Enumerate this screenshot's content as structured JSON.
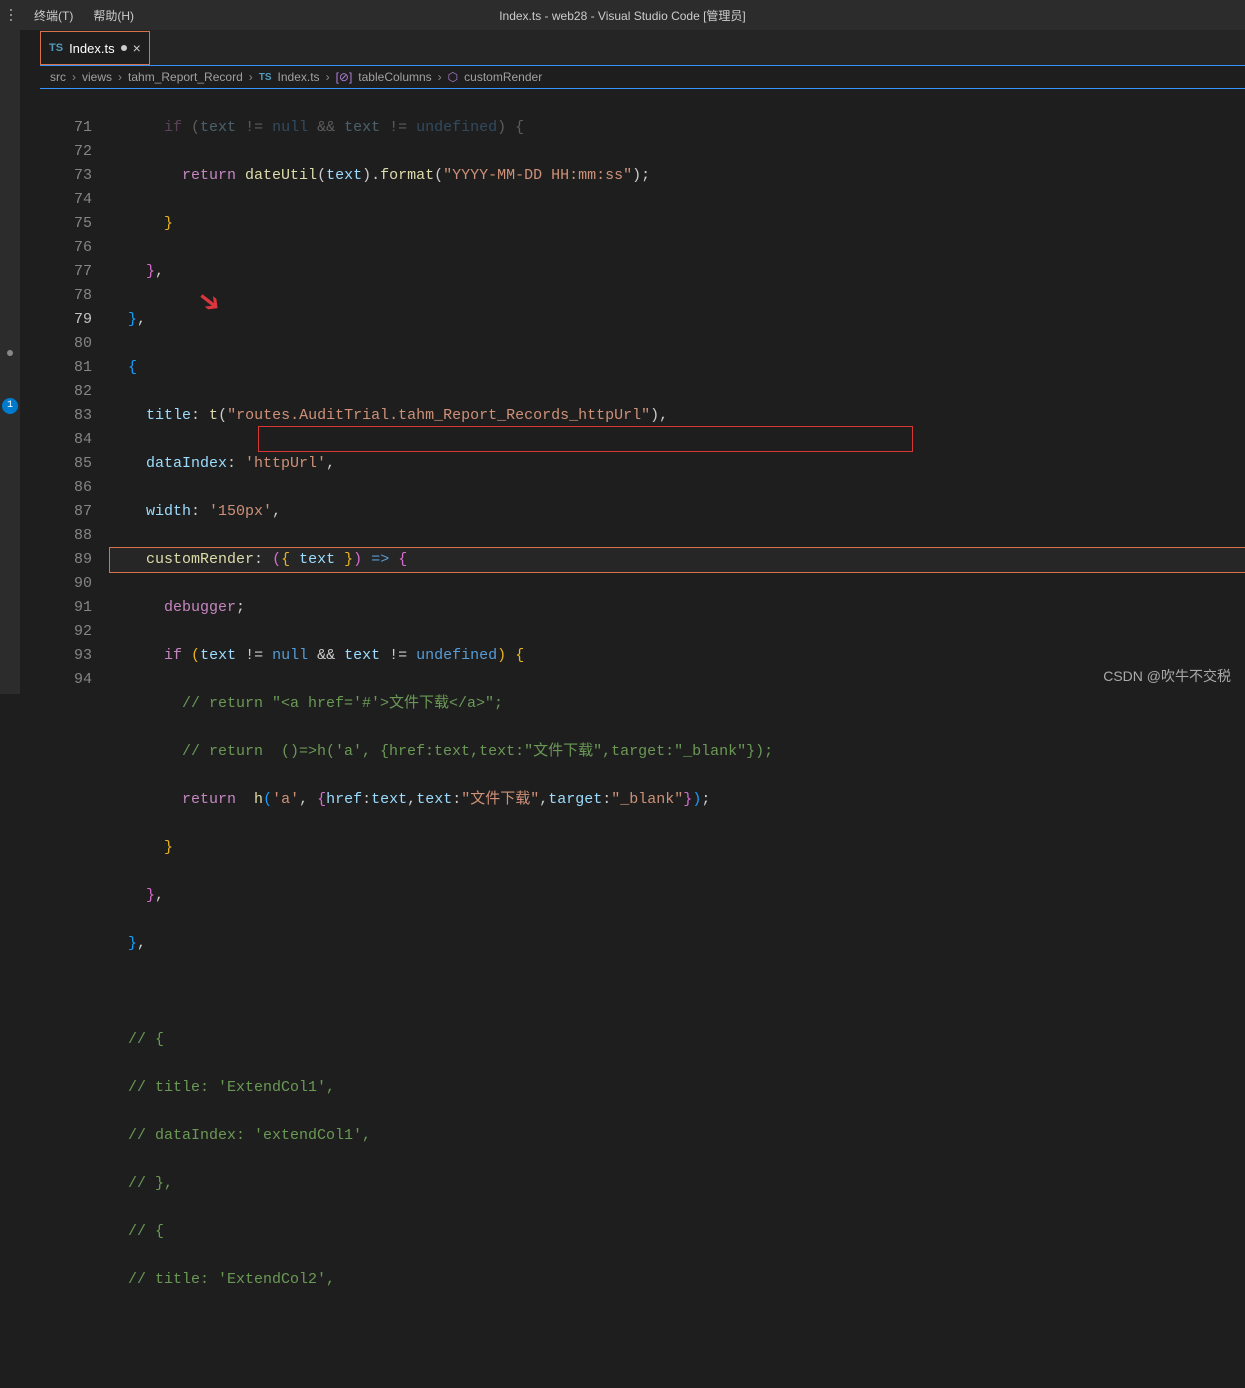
{
  "menubar": {
    "terminal": "终端(T)",
    "help": "帮助(H)"
  },
  "window_title": "Index.ts - web28 - Visual Studio Code [管理员]",
  "activitybar": {
    "badge": "1"
  },
  "tab": {
    "icon": "TS",
    "name": "Index.ts"
  },
  "breadcrumb": {
    "items": [
      "src",
      "views",
      "tahm_Report_Record",
      "Index.ts",
      "tableColumns",
      "customRender"
    ],
    "ts_icon": "TS"
  },
  "line_numbers": [
    "71",
    "72",
    "73",
    "74",
    "75",
    "76",
    "77",
    "78",
    "79",
    "80",
    "81",
    "82",
    "83",
    "84",
    "85",
    "86",
    "87",
    "88",
    "89",
    "90",
    "91",
    "92",
    "93",
    "94"
  ],
  "code": {
    "l70": "if (text != null && text != undefined) {",
    "l71_return": "return",
    "l71_fn": "dateUtil",
    "l71_id": "text",
    "l71_fn2": "format",
    "l71_str": "\"YYYY-MM-DD HH:mm:ss\"",
    "l76_title": "title",
    "l76_fn": "t",
    "l76_str": "\"routes.AuditTrial.tahm_Report_Records_httpUrl\"",
    "l77_key": "dataIndex",
    "l77_str": "'httpUrl'",
    "l78_key": "width",
    "l78_str": "'150px'",
    "l79_key": "customRender",
    "l79_id": "text",
    "l80_dbg": "debugger",
    "l81_if": "if",
    "l81_id1": "text",
    "l81_null": "null",
    "l81_id2": "text",
    "l81_undef": "undefined",
    "l82_cm": "// return \"<a href='#'>文件下载</a>\";",
    "l83_cm": "// return  ()=>h('a', {href:text,text:\"文件下载\",target:\"_blank\"});",
    "l84_ret": "return",
    "l84_fn": "h",
    "l84_str1": "'a'",
    "l84_href": "href",
    "l84_text": "text",
    "l84_textk": "text",
    "l84_str2": "\"文件下载\"",
    "l84_target": "target",
    "l84_str3": "\"_blank\"",
    "l89_cm": "// {",
    "l90_cm": "// title: 'ExtendCol1',",
    "l91_cm": "// dataIndex: 'extendCol1',",
    "l92_cm": "// },",
    "l93_cm": "// {",
    "l94_cm": "// title: 'ExtendCol2',"
  },
  "watermark": "CSDN @吹牛不交税"
}
